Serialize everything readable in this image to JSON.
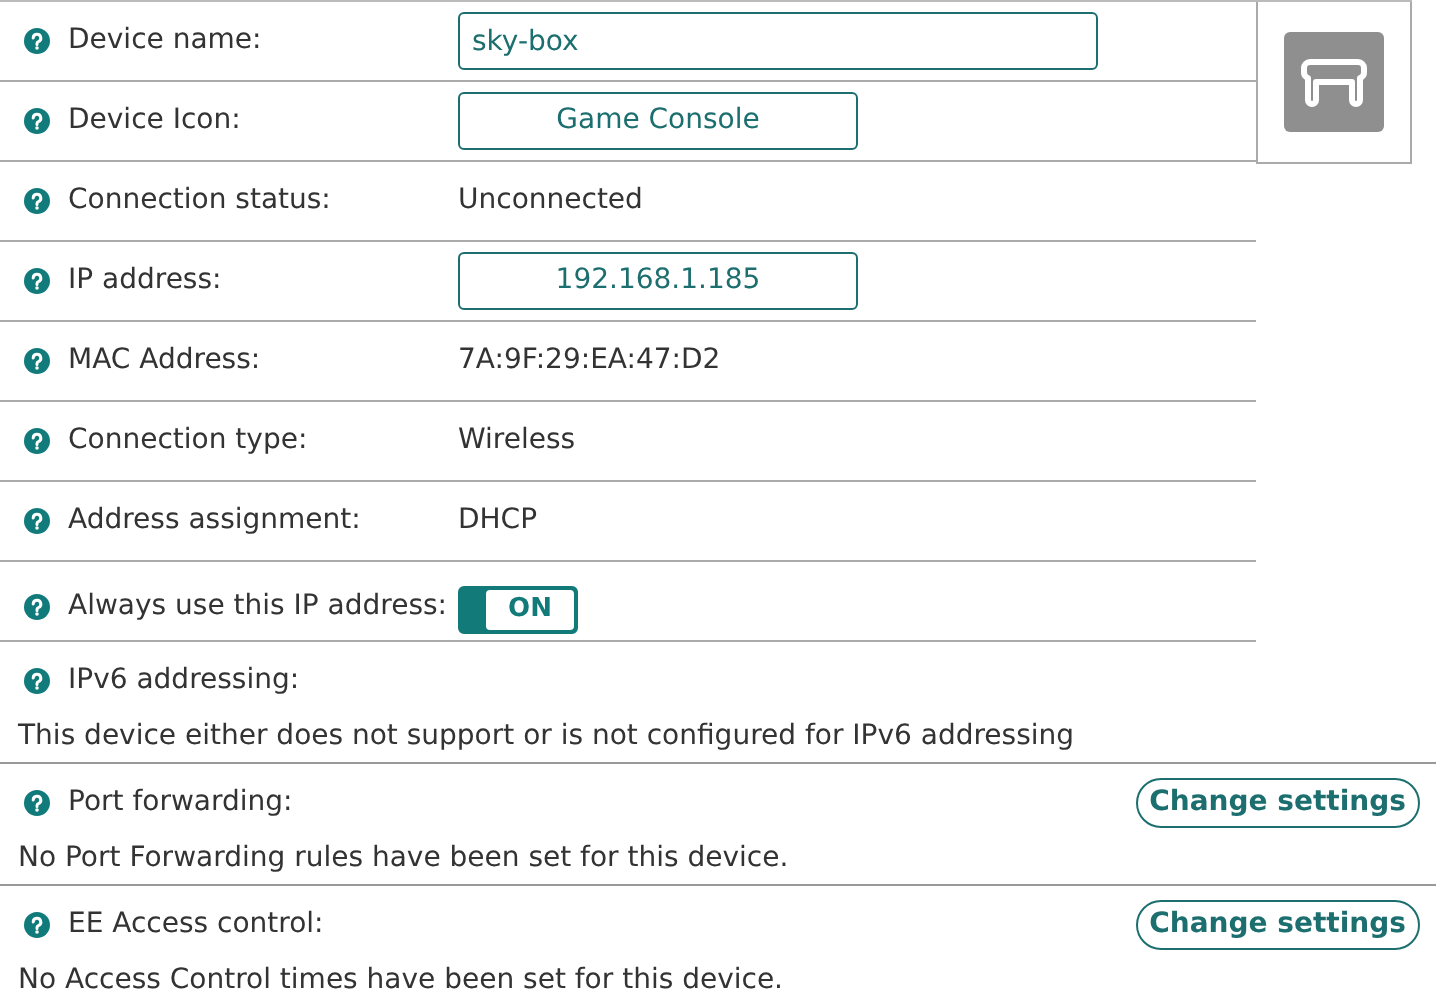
{
  "rows": [
    {
      "label": "Device name:",
      "kind": "field",
      "value": "sky-box"
    },
    {
      "label": "Device Icon:",
      "kind": "button",
      "value": "Game Console"
    },
    {
      "label": "Connection status:",
      "kind": "text",
      "value": "Unconnected"
    },
    {
      "label": "IP address:",
      "kind": "button",
      "value": "192.168.1.185"
    },
    {
      "label": "MAC Address:",
      "kind": "text",
      "value": "7A:9F:29:EA:47:D2"
    },
    {
      "label": "Connection type:",
      "kind": "text",
      "value": "Wireless"
    },
    {
      "label": "Address assignment:",
      "kind": "text",
      "value": "DHCP"
    },
    {
      "label": "Always use this IP address:",
      "kind": "toggle",
      "on": true,
      "value": "ON"
    }
  ],
  "sections": [
    {
      "label": "IPv6 addressing:",
      "message": "This device either does not support or is not configured for IPv6 addressing"
    },
    {
      "label": "Port forwarding:",
      "button": "Change settings",
      "message": "No Port Forwarding rules have been set for this device."
    },
    {
      "label": "EE Access control:",
      "button": "Change settings",
      "message": "No Access Control times have been set for this device."
    }
  ]
}
